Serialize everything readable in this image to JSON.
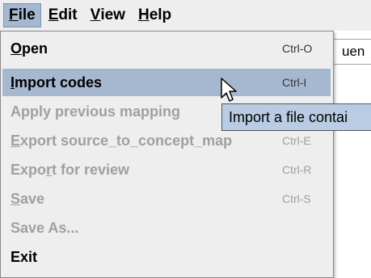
{
  "menubar": {
    "items": [
      {
        "label": "File",
        "mnemonic": "F",
        "rest": "ile"
      },
      {
        "label": "Edit",
        "mnemonic": "E",
        "rest": "dit"
      },
      {
        "label": "View",
        "mnemonic": "V",
        "rest": "iew"
      },
      {
        "label": "Help",
        "mnemonic": "H",
        "rest": "elp"
      }
    ]
  },
  "background": {
    "field_text": "uen"
  },
  "file_menu": {
    "items": [
      {
        "pre": "",
        "mn": "O",
        "post": "pen",
        "accel": "Ctrl-O",
        "state": "enabled"
      },
      {
        "pre": "",
        "mn": "I",
        "post": "mport codes",
        "accel": "Ctrl-I",
        "state": "selected"
      },
      {
        "pre": "Apply previous mapping",
        "mn": "",
        "post": "",
        "accel": "",
        "state": "disabled"
      },
      {
        "pre": "",
        "mn": "E",
        "post": "xport source_to_concept_map",
        "accel": "Ctrl-E",
        "state": "disabled"
      },
      {
        "pre": "Expo",
        "mn": "r",
        "post": "t for review",
        "accel": "Ctrl-R",
        "state": "disabled"
      },
      {
        "pre": "",
        "mn": "S",
        "post": "ave",
        "accel": "Ctrl-S",
        "state": "disabled"
      },
      {
        "pre": "Save As...",
        "mn": "",
        "post": "",
        "accel": "",
        "state": "disabled"
      },
      {
        "pre": "Exit",
        "mn": "",
        "post": "",
        "accel": "",
        "state": "enabled"
      }
    ]
  },
  "tooltip": {
    "text": "Import a file contai"
  },
  "colors": {
    "selection": "#a6b8cf",
    "tooltip_bg": "#b9cce3",
    "menu_bg": "#eeeeee",
    "disabled_text": "#a0a0a0"
  }
}
